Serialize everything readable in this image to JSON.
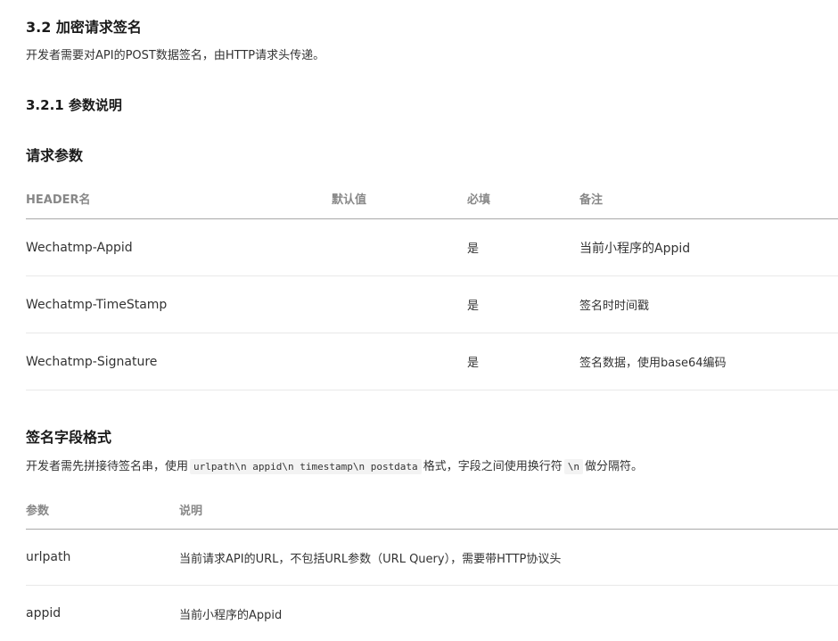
{
  "section": {
    "title": "3.2 加密请求签名",
    "description": "开发者需要对API的POST数据签名，由HTTP请求头传递。"
  },
  "subsection": {
    "title": "3.2.1 参数说明"
  },
  "request_params": {
    "title": "请求参数",
    "headers": [
      "HEADER名",
      "默认值",
      "必填",
      "备注"
    ],
    "rows": [
      {
        "name": "Wechatmp-Appid",
        "default": "",
        "required": "是",
        "note": "当前小程序的Appid"
      },
      {
        "name": "Wechatmp-TimeStamp",
        "default": "",
        "required": "是",
        "note": "签名时时间戳"
      },
      {
        "name": "Wechatmp-Signature",
        "default": "",
        "required": "是",
        "note": "签名数据，使用base64编码"
      }
    ]
  },
  "sign_format": {
    "title": "签名字段格式",
    "desc_prefix": "开发者需先拼接待签名串，使用",
    "format_code": "urlpath\\n appid\\n timestamp\\n postdata",
    "desc_middle": "格式，字段之间使用换行符",
    "newline_code": "\\n",
    "desc_suffix": "做分隔符。",
    "headers": [
      "参数",
      "说明"
    ],
    "rows": [
      {
        "param": "urlpath",
        "desc": "当前请求API的URL，不包括URL参数（URL Query），需要带HTTP协议头"
      },
      {
        "param": "appid",
        "desc": "当前小程序的Appid"
      }
    ]
  }
}
